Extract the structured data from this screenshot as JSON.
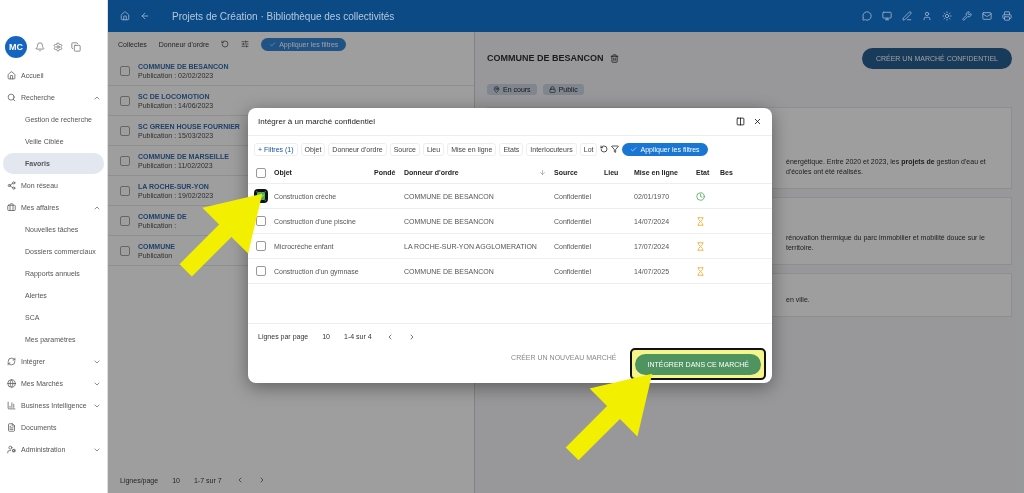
{
  "sidebar": {
    "avatar": "MC",
    "items": [
      {
        "label": "Accueil"
      },
      {
        "label": "Recherche",
        "expanded": true,
        "children": [
          {
            "label": "Gestion de recherche",
            "selected": false
          },
          {
            "label": "Veille Ciblée",
            "selected": false
          },
          {
            "label": "Favoris",
            "selected": true
          }
        ]
      },
      {
        "label": "Mon réseau"
      },
      {
        "label": "Mes affaires",
        "expanded": true,
        "children": [
          {
            "label": "Nouvelles tâches",
            "selected": false
          },
          {
            "label": "Dossiers commerciaux",
            "selected": false
          },
          {
            "label": "Rapports annuels",
            "selected": false
          },
          {
            "label": "Alertes",
            "selected": false
          },
          {
            "label": "SCA",
            "selected": false
          },
          {
            "label": "Mes paramètres",
            "selected": false
          }
        ]
      },
      {
        "label": "Intégrer",
        "expanded": false
      },
      {
        "label": "Mes Marchés",
        "expanded": false
      },
      {
        "label": "Business Intelligence",
        "expanded": false
      },
      {
        "label": "Documents"
      },
      {
        "label": "Administration",
        "expanded": false
      }
    ]
  },
  "topbar": {
    "title": "Projets de Création · Bibliothèque des collectivités"
  },
  "list": {
    "toolbar": [
      "Collectes",
      "Donneur d'ordre"
    ],
    "apply": "Appliquer les filtres",
    "rows": [
      {
        "checked": false,
        "title": "COMMUNE DE BESANCON",
        "subtitle": "Publication : 02/02/2023"
      },
      {
        "checked": false,
        "title": "SC DE LOCOMOTION",
        "subtitle": "Publication : 14/06/2023"
      },
      {
        "checked": false,
        "title": "SC GREEN HOUSE FOURNIER",
        "subtitle": "Publication : 15/03/2023"
      },
      {
        "checked": false,
        "title": "COMMUNE DE MARSEILLE",
        "subtitle": "Publication : 11/02/2023"
      },
      {
        "checked": false,
        "title": "LA ROCHE-SUR-YON",
        "subtitle": "Publication : 19/02/2023"
      },
      {
        "checked": false,
        "title": "COMMUNE DE",
        "subtitle": "Publication :"
      },
      {
        "checked": false,
        "title": "COMMUNE",
        "subtitle": "Publication"
      }
    ],
    "footer": {
      "label": "Lignes/page",
      "size": "10",
      "range": "1-7 sur 7"
    }
  },
  "detail": {
    "title": "COMMUNE DE BESANCON",
    "action": "CRÉER UN MARCHÉ CONFIDENTIEL",
    "chips": [
      "En cours",
      "Public"
    ],
    "paragraphs": [
      "énergétique. Entre 2020 et 2023, les **projets de** gestion d'eau et d'écoles ont été réalisés.",
      "rénovation thermique du parc immobilier et mobilité douce sur le territoire.",
      "en ville."
    ]
  },
  "dialog": {
    "title": "Intégrer à un marché confidentiel",
    "filters": [
      "+ Filtres (1)",
      "Objet",
      "Donneur d'ordre",
      "Source",
      "Lieu",
      "Mise en ligne",
      "Etats",
      "Interlocuteurs",
      "Lot"
    ],
    "apply": "Appliquer les filtres",
    "select_all": {
      "checked": false
    },
    "columns": [
      "Objet",
      "Pondé",
      "Donneur d'ordre",
      "Source",
      "Lieu",
      "Mise en ligne",
      "Etat",
      "Bes"
    ],
    "rows": [
      {
        "checked": true,
        "object": "Construction crèche",
        "client": "COMMUNE DE BESANCON",
        "source": "Confidentiel",
        "date": "02/01/1970",
        "kind": "done"
      },
      {
        "checked": false,
        "object": "Construction d'une piscine",
        "client": "COMMUNE DE BESANCON",
        "source": "Confidentiel",
        "date": "14/07/2024",
        "kind": "pending"
      },
      {
        "checked": false,
        "object": "Microcrèche enfant",
        "client": "LA ROCHE-SUR-YON AGGLOMERATION",
        "source": "Confidentiel",
        "date": "17/07/2024",
        "kind": "pending"
      },
      {
        "checked": false,
        "object": "Construction d'un gymnase",
        "client": "COMMUNE DE BESANCON",
        "source": "Confidentiel",
        "date": "14/07/2025",
        "kind": "pending"
      }
    ],
    "footer": {
      "label": "Lignes par page",
      "size": "10",
      "range": "1-4 sur 4"
    },
    "secondary": "CRÉER UN NOUVEAU MARCHÉ",
    "primary": "INTÉGRER DANS CE MARCHÉ"
  }
}
